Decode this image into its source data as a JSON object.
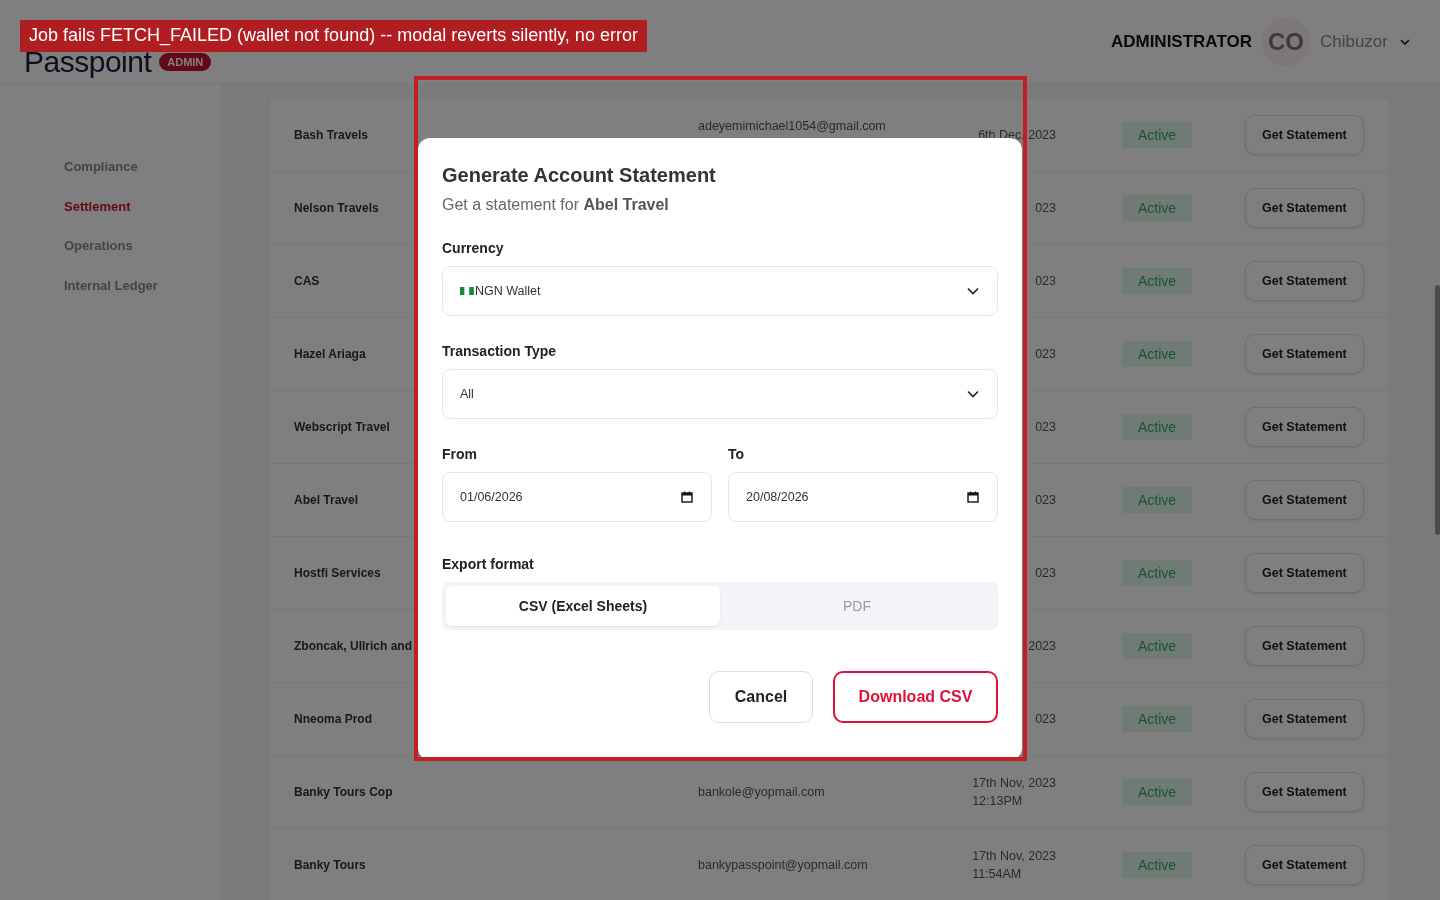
{
  "banner": {
    "text": "Job fails **FETCH_FAILED** (wallet not found) -- modal reverts silently, no error"
  },
  "header": {
    "logo": "Passpoint",
    "badge": "ADMIN",
    "role": "ADMINISTRATOR",
    "avatar": "CO",
    "user": "Chibuzor"
  },
  "sidebar": {
    "items": [
      {
        "label": "Compliance",
        "selected": false
      },
      {
        "label": "Settlement",
        "selected": true
      },
      {
        "label": "Operations",
        "selected": false
      },
      {
        "label": "Internal Ledger",
        "selected": false
      }
    ]
  },
  "table": {
    "rows": [
      {
        "name": "Bash Travels",
        "email": "adeyemimichael1054@gmail.com",
        "date": "6th Dec, 2023",
        "status": "Active",
        "action": "Get Statement"
      },
      {
        "name": "Nelson Travels",
        "date": "023",
        "status": "Active",
        "action": "Get Statement"
      },
      {
        "name": "CAS",
        "date": "023",
        "status": "Active",
        "action": "Get Statement"
      },
      {
        "name": "Hazel Ariaga",
        "date": "023",
        "status": "Active",
        "action": "Get Statement"
      },
      {
        "name": "Webscript Travel",
        "date": "023",
        "status": "Active",
        "action": "Get Statement"
      },
      {
        "name": "Abel Travel",
        "date": "023",
        "status": "Active",
        "action": "Get Statement"
      },
      {
        "name": "Hostfi Services",
        "date": "023",
        "status": "Active",
        "action": "Get Statement"
      },
      {
        "name": "Zboncak, Ullrich and",
        "date": "2023",
        "status": "Active",
        "action": "Get Statement"
      },
      {
        "name": "Nneoma Prod",
        "date": "023",
        "status": "Active",
        "action": "Get Statement"
      },
      {
        "name": "Banky Tours Cop",
        "email": "bankole@yopmail.com",
        "date": "17th Nov, 2023",
        "time": "12:13PM",
        "status": "Active",
        "action": "Get Statement"
      },
      {
        "name": "Banky Tours",
        "email": "bankypasspoint@yopmail.com",
        "date": "17th Nov, 2023",
        "time": "11:54AM",
        "status": "Active",
        "action": "Get Statement"
      }
    ]
  },
  "modal": {
    "title": "Generate Account Statement",
    "subtitle": "Get a statement for **Abel Travel**",
    "currency": {
      "label": "Currency",
      "value": "NGN Wallet"
    },
    "transaction_type": {
      "label": "Transaction Type",
      "value": "All"
    },
    "from": {
      "label": "From",
      "value": "01/06/2026"
    },
    "to": {
      "label": "To",
      "value": "20/08/2026"
    },
    "export_format": {
      "label": "Export format",
      "options": [
        {
          "label": "CSV (Excel Sheets)",
          "selected": true
        },
        {
          "label": "PDF",
          "selected": false
        }
      ]
    },
    "buttons": [
      {
        "label": "Cancel",
        "kind": "secondary"
      },
      {
        "label": "Download CSV",
        "kind": "primary"
      }
    ]
  }
}
